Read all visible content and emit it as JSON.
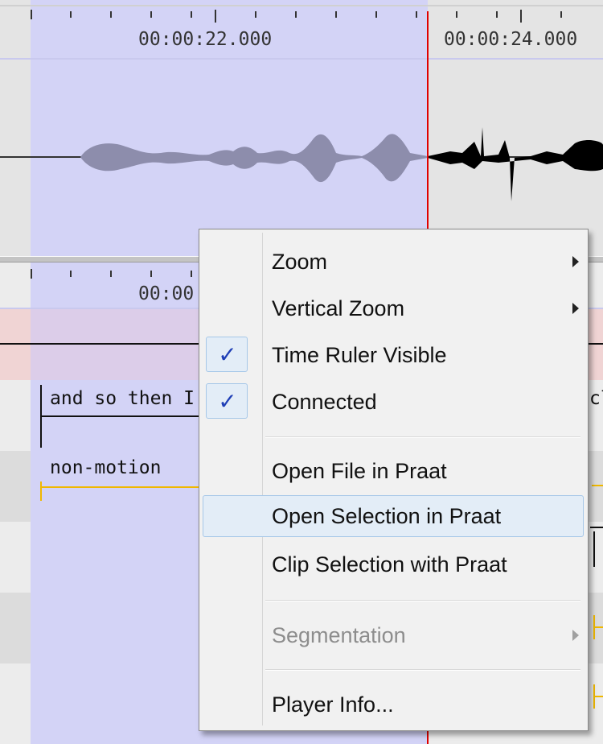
{
  "ruler": {
    "label_22": "00:00:22.000",
    "label_24": "00:00:24.000",
    "label_bottom_partial": "00:00"
  },
  "tiers": {
    "words_text": "and so then I",
    "words_right_partial": "cl",
    "motion_text": "non-motion"
  },
  "menu": {
    "items": [
      {
        "label": "Zoom",
        "submenu": true
      },
      {
        "label": "Vertical Zoom",
        "submenu": true
      },
      {
        "label": "Time Ruler Visible",
        "checked": true
      },
      {
        "label": "Connected",
        "checked": true
      },
      {
        "label": "Open File in Praat"
      },
      {
        "label": "Open Selection in Praat",
        "highlighted": true
      },
      {
        "label": "Clip Selection with Praat"
      },
      {
        "label": "Segmentation",
        "submenu": true,
        "disabled": true
      },
      {
        "label": "Player Info..."
      }
    ],
    "check_glyph": "✓"
  },
  "colors": {
    "selection": "#d3d3f6",
    "cursor": "#e00000",
    "tier_accent": "#f0b800",
    "menu_highlight": "#e3edf7",
    "check": "#1f3fb6"
  },
  "icons": {
    "check": "check-icon",
    "submenu": "chevron-right-icon"
  }
}
